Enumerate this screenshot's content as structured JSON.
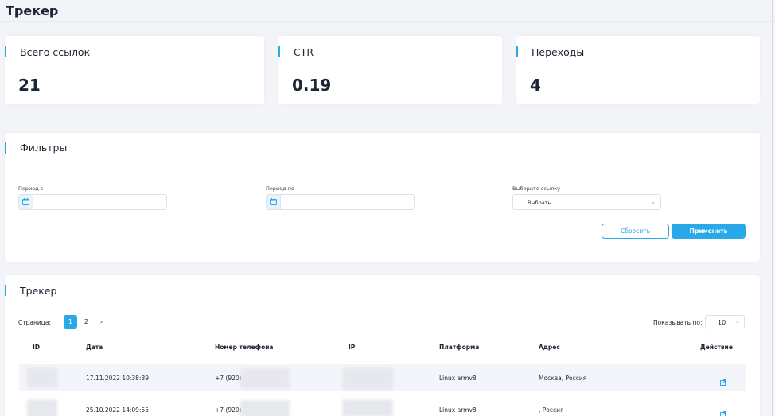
{
  "header": {
    "title": "Трекер"
  },
  "stats": [
    {
      "label": "Всего ссылок",
      "value": "21"
    },
    {
      "label": "CTR",
      "value": "0.19"
    },
    {
      "label": "Переходы",
      "value": "4"
    }
  ],
  "filters": {
    "title": "Фильтры",
    "period_from_label": "Период с",
    "period_to_label": "Период по",
    "link_label": "Выберите ссылку",
    "link_select_value": "Выбрать",
    "reset_label": "Сбросить",
    "apply_label": "Применить"
  },
  "tracker": {
    "title": "Трекер",
    "page_label": "Страница:",
    "pages": [
      "1",
      "2"
    ],
    "next_label": "›",
    "per_page_label": "Показывать по:",
    "per_page_value": "10",
    "columns": [
      "ID",
      "Дата",
      "Номер телефона",
      "IP",
      "Платформа",
      "Адрес",
      "Действие"
    ],
    "rows": [
      {
        "date": "17.11.2022 10:38:39",
        "phone": "+7 (920)",
        "platform": "Linux armv8l",
        "address": "Москва, Россия"
      },
      {
        "date": "25.10.2022 14:09:55",
        "phone": "+7 (920)",
        "platform": "Linux armv8l",
        "address": ", Россия"
      }
    ]
  },
  "colors": {
    "accent": "#2aa9e8",
    "background": "#f3f4f8",
    "text": "#1d2434"
  },
  "icons": {
    "calendar": "calendar-icon",
    "action": "external-link-icon",
    "chevron": "chevron-down-icon"
  }
}
